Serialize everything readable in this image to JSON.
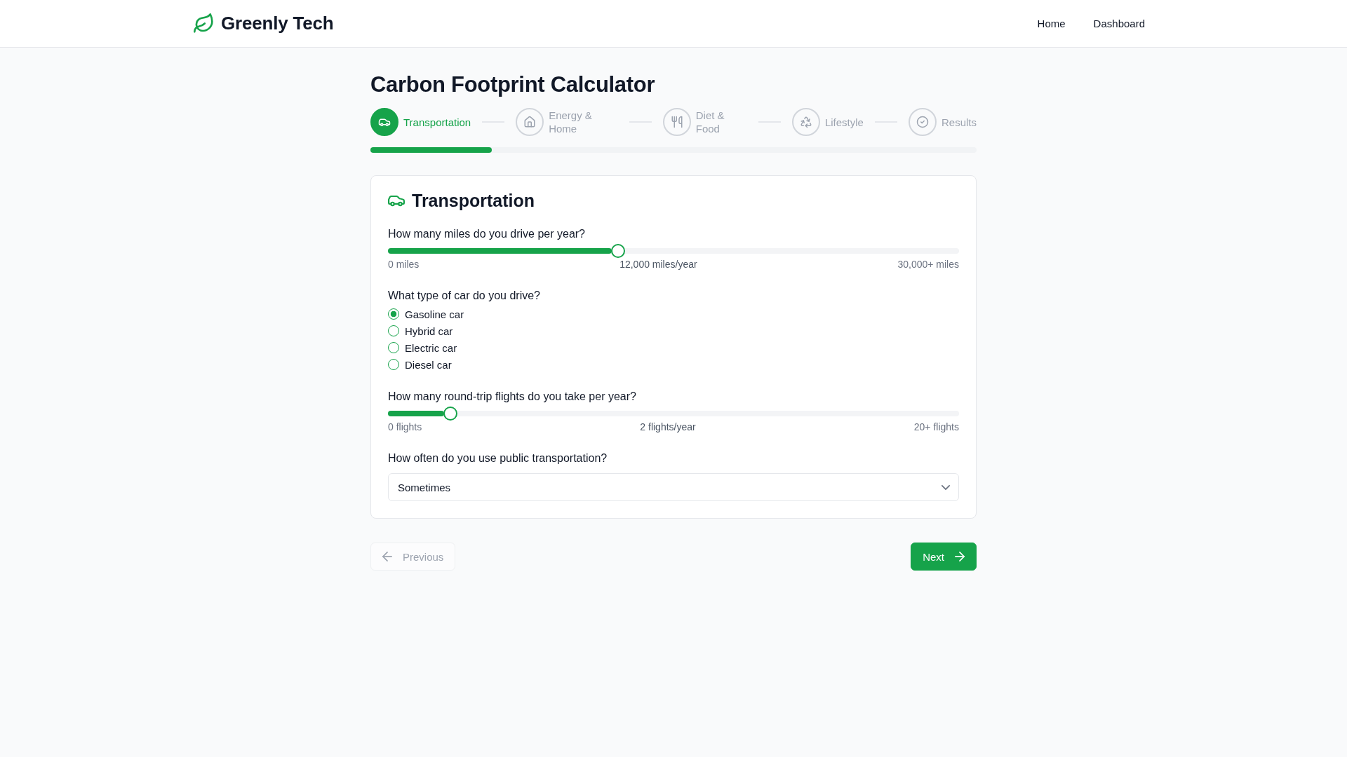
{
  "header": {
    "brand": "Greenly Tech",
    "nav": [
      {
        "label": "Home"
      },
      {
        "label": "Dashboard"
      }
    ]
  },
  "page": {
    "title": "Carbon Footprint Calculator"
  },
  "steps": [
    {
      "label": "Transportation",
      "selected": true
    },
    {
      "label": "Energy & Home",
      "selected": false
    },
    {
      "label": "Diet & Food",
      "selected": false
    },
    {
      "label": "Lifestyle",
      "selected": false
    },
    {
      "label": "Results",
      "selected": false
    }
  ],
  "progress": {
    "level": 0.2
  },
  "card": {
    "title": "Transportation",
    "questions": [
      {
        "kind": "slider",
        "label": "How many miles do you drive per year?",
        "level": 0.4,
        "min_label": "0 miles",
        "value_label": "12,000 miles/year",
        "max_label": "30,000+ miles"
      },
      {
        "kind": "radio",
        "label": "What type of car do you drive?",
        "options": [
          {
            "label": "Gasoline car",
            "selected": true
          },
          {
            "label": "Hybrid car",
            "selected": false
          },
          {
            "label": "Electric car",
            "selected": false
          },
          {
            "label": "Diesel car",
            "selected": false
          }
        ]
      },
      {
        "kind": "slider",
        "label": "How many round-trip flights do you take per year?",
        "level": 0.1,
        "min_label": "0 flights",
        "value_label": "2 flights/year",
        "max_label": "20+ flights"
      },
      {
        "kind": "select",
        "label": "How often do you use public transportation?",
        "value": "Sometimes"
      }
    ]
  },
  "buttons": [
    {
      "kind": "previous",
      "label": "Previous",
      "disabled": true
    },
    {
      "kind": "next",
      "label": "Next",
      "disabled": false
    }
  ]
}
